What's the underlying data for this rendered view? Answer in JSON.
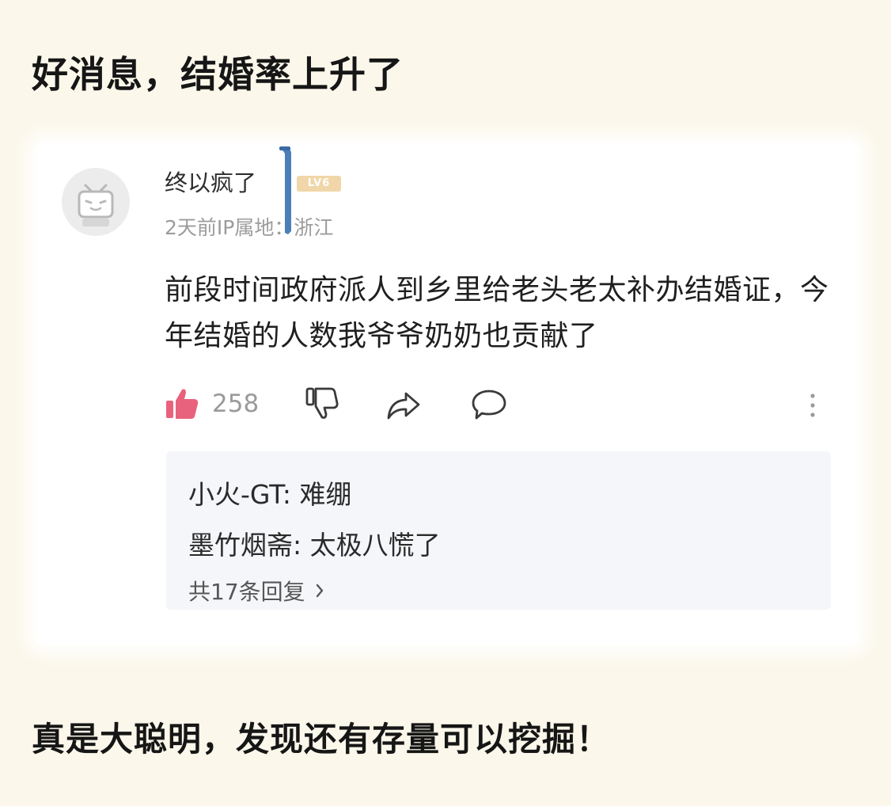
{
  "headline": "好消息，结婚率上升了",
  "comment": {
    "username": "终以疯了",
    "level_badge": "LV6",
    "meta": "2天前IP属地：浙江",
    "text": "前段时间政府派人到乡里给老头老太补办结婚证，今年结婚的人数我爷爷奶奶也贡献了",
    "like_count": "258",
    "icons": {
      "avatar": "bilibili-tv-avatar-icon",
      "like": "thumbs-up-icon",
      "dislike": "thumbs-down-icon",
      "share": "share-arrow-icon",
      "reply": "speech-bubble-icon",
      "more": "vertical-ellipsis-icon"
    },
    "colors": {
      "like": "#e8627e",
      "badge": "#f0d6a8",
      "muted": "#9a9a9a"
    }
  },
  "replies": {
    "items": [
      {
        "author": "小火-GT",
        "text": "难绷"
      },
      {
        "author": "墨竹烟斋",
        "text": "太极八慌了"
      }
    ],
    "total_label": "共17条回复"
  },
  "footer": "真是大聪明，发现还有存量可以挖掘！"
}
